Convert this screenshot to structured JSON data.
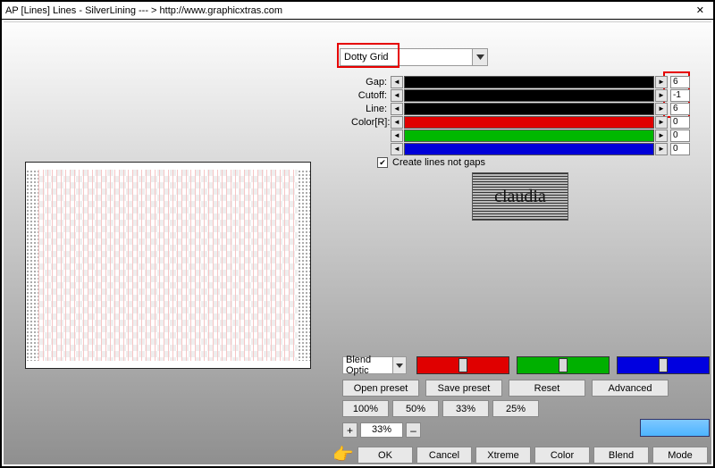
{
  "window": {
    "title": "AP [Lines]  Lines - SilverLining    --- >  http://www.graphicxtras.com"
  },
  "combo": {
    "selected": "Dotty Grid"
  },
  "params": {
    "gap": {
      "label": "Gap:",
      "value": "6"
    },
    "cutoff": {
      "label": "Cutoff:",
      "value": "-1"
    },
    "line": {
      "label": "Line:",
      "value": "6"
    },
    "colorR": {
      "label": "Color[R]:",
      "value": "0"
    },
    "colorG": {
      "label": "",
      "value": "0"
    },
    "colorB": {
      "label": "",
      "value": "0"
    }
  },
  "checkbox": {
    "label": "Create lines not gaps",
    "checked": true
  },
  "logo_text": "claudia",
  "blend_options": {
    "label": "Blend Optic"
  },
  "buttons": {
    "open_preset": "Open preset",
    "save_preset": "Save preset",
    "reset": "Reset",
    "advanced": "Advanced",
    "p100": "100%",
    "p50": "50%",
    "p33": "33%",
    "p25": "25%",
    "ok": "OK",
    "cancel": "Cancel",
    "xtreme": "Xtreme",
    "color": "Color",
    "blend": "Blend",
    "mode": "Mode"
  },
  "zoom": {
    "value": "33%",
    "plus": "+",
    "minus": "–"
  },
  "swatch_color": "#55b8ff",
  "icons": {
    "pointer": "👉"
  }
}
